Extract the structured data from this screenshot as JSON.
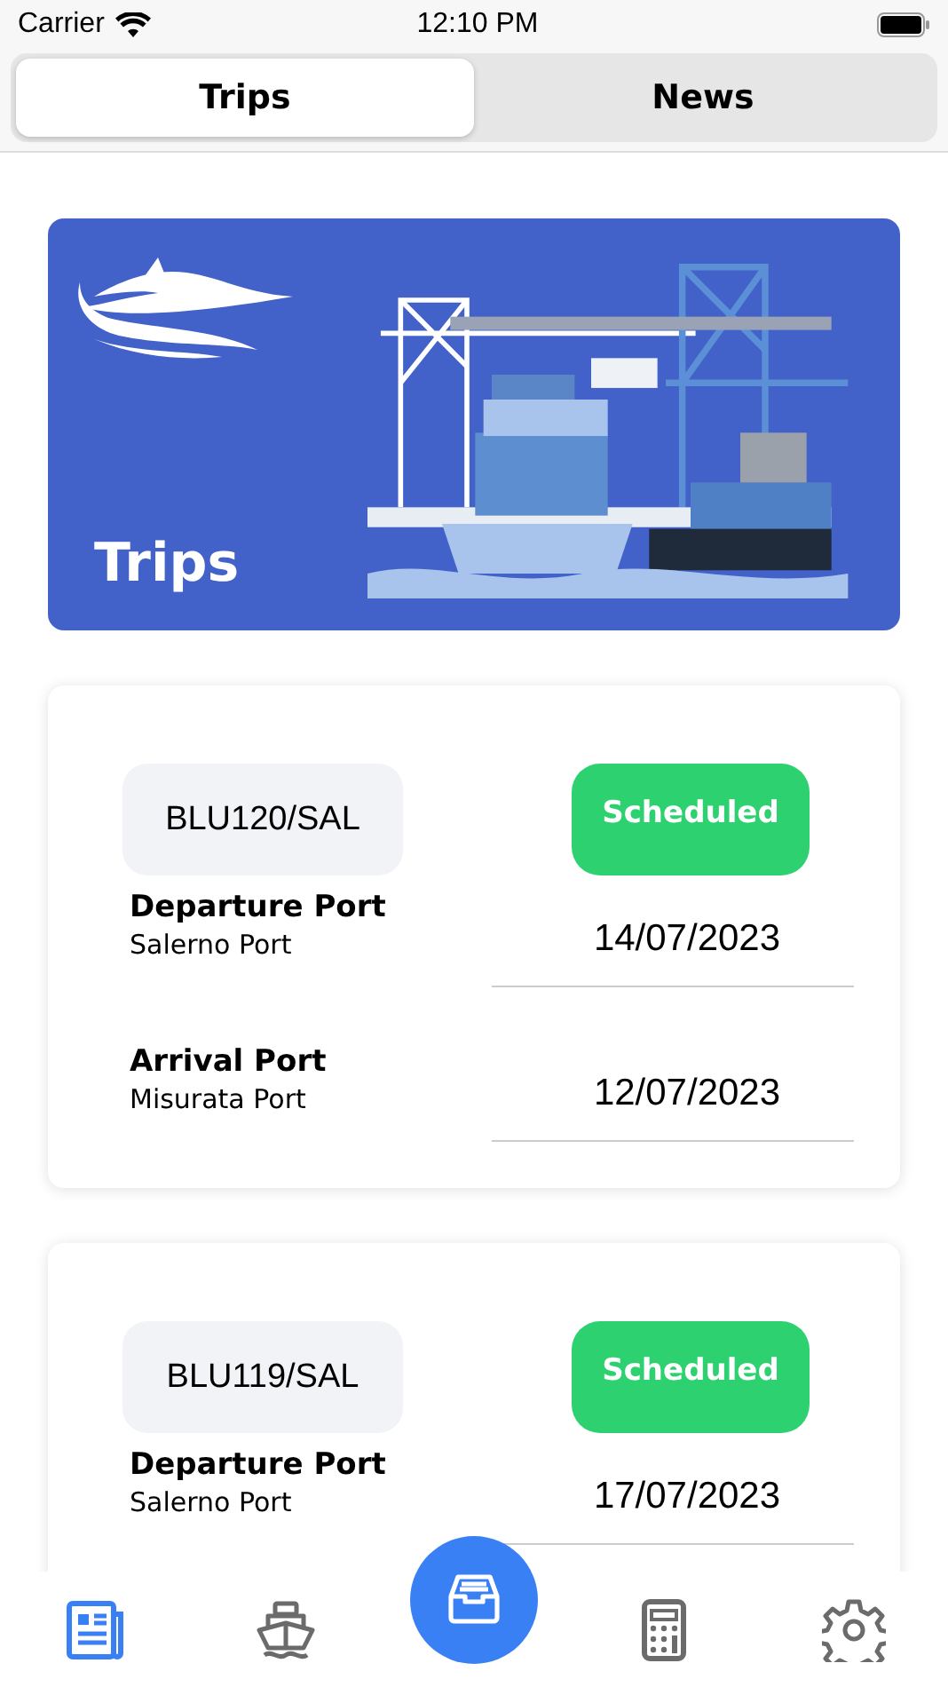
{
  "status_bar": {
    "carrier": "Carrier",
    "time": "12:10 PM"
  },
  "segments": [
    {
      "label": "Trips",
      "selected": true
    },
    {
      "label": "News",
      "selected": false
    }
  ],
  "banner": {
    "title": "Trips",
    "kind": "picture"
  },
  "trips": [
    {
      "code": "BLU120/SAL",
      "status": "Scheduled",
      "color": "#2ed170",
      "stops": [
        {
          "label": "Departure Port",
          "port": "Salerno Port",
          "date": "14/07/2023"
        },
        {
          "label": "Arrival Port",
          "port": "Misurata Port",
          "date": "12/07/2023"
        }
      ]
    },
    {
      "code": "BLU119/SAL",
      "status": "Scheduled",
      "color": "#2ed170",
      "stops": [
        {
          "label": "Departure Port",
          "port": "Salerno Port",
          "date": "17/07/2023"
        }
      ]
    }
  ],
  "tab_bar": [
    {
      "kind": "newspaper",
      "selected": true
    },
    {
      "kind": "ship",
      "selected": false
    },
    {
      "kind": "inbox",
      "selected": false
    },
    {
      "kind": "calculator",
      "selected": false
    },
    {
      "kind": "settings",
      "selected": false
    }
  ]
}
